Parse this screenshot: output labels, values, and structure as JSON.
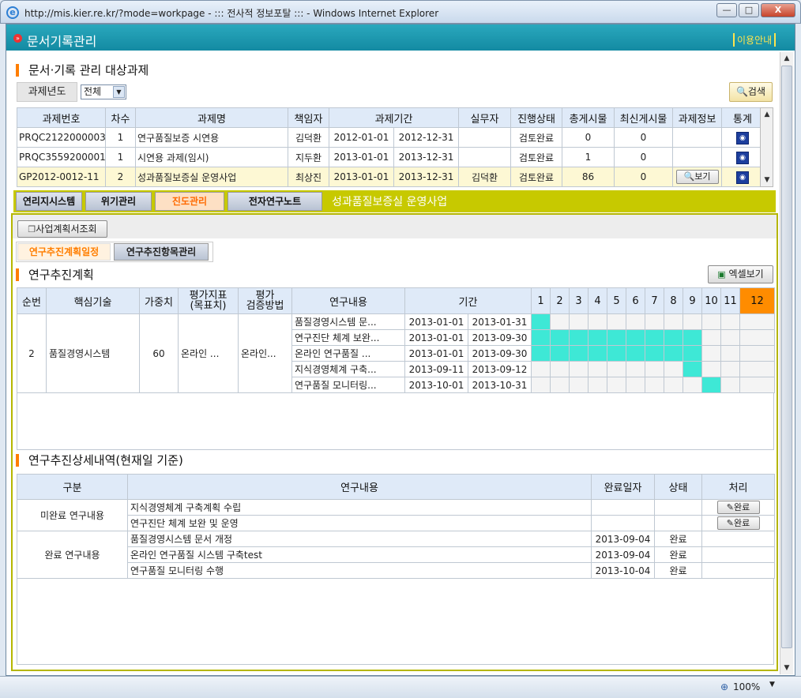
{
  "window": {
    "url": "http://mis.kier.re.kr/?mode=workpage - ::: 전사적 정보포탈 ::: - Windows Internet Explorer",
    "min": "—",
    "max": "□",
    "close": "X"
  },
  "app": {
    "title": "문서기록관리",
    "help": "이용안내"
  },
  "section1": {
    "title": "문서·기록 관리 대상과제",
    "year_label": "과제년도",
    "year_value": "전체",
    "search": "검색"
  },
  "projects": {
    "headers": [
      "과제번호",
      "차수",
      "과제명",
      "책임자",
      "과제기간",
      "실무자",
      "진행상태",
      "총게시물",
      "최신게시물",
      "과제정보",
      "통계"
    ],
    "rows": [
      {
        "no": "PRQC2122000003",
        "seq": "1",
        "name": "연구품질보증 시연용",
        "owner": "김덕환",
        "start": "2012-01-01",
        "end": "2012-12-31",
        "worker": "",
        "status": "검토완료",
        "total": "0",
        "latest": "0",
        "info": ""
      },
      {
        "no": "PRQC3559200001",
        "seq": "1",
        "name": "시연용 과제(임시)",
        "owner": "지두환",
        "start": "2013-01-01",
        "end": "2013-12-31",
        "worker": "",
        "status": "검토완료",
        "total": "1",
        "latest": "0",
        "info": ""
      },
      {
        "no": "GP2012-0012-11",
        "seq": "2",
        "name": "성과품질보증실 운영사업",
        "owner": "최상진",
        "start": "2013-01-01",
        "end": "2013-12-31",
        "worker": "김덕환",
        "status": "검토완료",
        "total": "86",
        "latest": "0",
        "info": "보기"
      }
    ]
  },
  "tabs": [
    "연리지시스템",
    "위기관리",
    "진도관리",
    "전자연구노트"
  ],
  "selected_project": "성과품질보증실 운영사업",
  "sub": {
    "plan_btn": "사업계획서조회",
    "tab1": "연구추진계획일정",
    "tab2": "연구추진항목관리"
  },
  "plan": {
    "title": "연구추진계획",
    "excel": "엑셀보기",
    "headers": {
      "seq": "순번",
      "tech": "핵심기술",
      "weight": "가중치",
      "idx1": "평가지표",
      "idx2": "(목표치)",
      "m1": "평가",
      "m2": "검증방법",
      "content": "연구내용",
      "period": "기간"
    },
    "months": [
      "1",
      "2",
      "3",
      "4",
      "5",
      "6",
      "7",
      "8",
      "9",
      "10",
      "11",
      "12"
    ],
    "current_month": 12,
    "group": {
      "seq": "2",
      "tech": "품질경영시스템",
      "weight": "60",
      "index": "온라인 ...",
      "method": "온라인..."
    },
    "items": [
      {
        "content": "품질경영시스템 문...",
        "start": "2013-01-01",
        "end": "2013-01-31",
        "from": 1,
        "to": 1
      },
      {
        "content": "연구진단 체계 보완...",
        "start": "2013-01-01",
        "end": "2013-09-30",
        "from": 1,
        "to": 9
      },
      {
        "content": "온라인 연구품질 ...",
        "start": "2013-01-01",
        "end": "2013-09-30",
        "from": 1,
        "to": 9
      },
      {
        "content": "지식경영체계 구축...",
        "start": "2013-09-11",
        "end": "2013-09-12",
        "from": 9,
        "to": 9
      },
      {
        "content": "연구품질 모니터링...",
        "start": "2013-10-01",
        "end": "2013-10-31",
        "from": 10,
        "to": 10
      }
    ]
  },
  "detail": {
    "title": "연구추진상세내역(현재일 기준)",
    "headers": [
      "구분",
      "연구내용",
      "완료일자",
      "상태",
      "처리"
    ],
    "incomplete_label": "미완료 연구내용",
    "complete_label": "완료 연구내용",
    "incomplete": [
      {
        "content": "지식경영체계 구축계획 수립",
        "date": "",
        "state": "",
        "action": "완료"
      },
      {
        "content": "연구진단 체계 보완 및 운영",
        "date": "",
        "state": "",
        "action": "완료"
      }
    ],
    "complete": [
      {
        "content": "품질경영시스템 문서 개정",
        "date": "2013-09-04",
        "state": "완료",
        "action": ""
      },
      {
        "content": "온라인 연구품질 시스템 구축test",
        "date": "2013-09-04",
        "state": "완료",
        "action": ""
      },
      {
        "content": "연구품질 모니터링 수행",
        "date": "2013-10-04",
        "state": "완료",
        "action": ""
      }
    ]
  },
  "status": {
    "zoom": "100%"
  },
  "colors": {
    "header": "#1a95ab",
    "accent": "#ff7e00",
    "bar": "#3ee8d6",
    "selected_band": "#c7c900"
  }
}
